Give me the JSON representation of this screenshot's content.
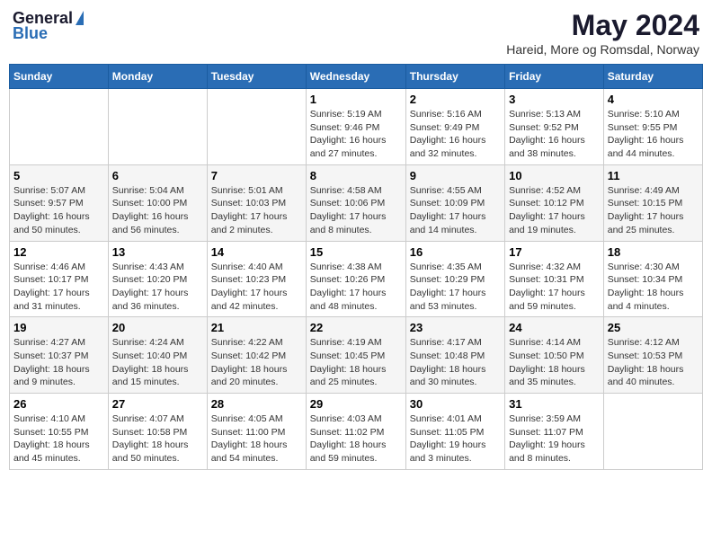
{
  "header": {
    "logo_general": "General",
    "logo_blue": "Blue",
    "month_year": "May 2024",
    "location": "Hareid, More og Romsdal, Norway"
  },
  "weekdays": [
    "Sunday",
    "Monday",
    "Tuesday",
    "Wednesday",
    "Thursday",
    "Friday",
    "Saturday"
  ],
  "weeks": [
    [
      {
        "day": "",
        "info": ""
      },
      {
        "day": "",
        "info": ""
      },
      {
        "day": "",
        "info": ""
      },
      {
        "day": "1",
        "info": "Sunrise: 5:19 AM\nSunset: 9:46 PM\nDaylight: 16 hours and 27 minutes."
      },
      {
        "day": "2",
        "info": "Sunrise: 5:16 AM\nSunset: 9:49 PM\nDaylight: 16 hours and 32 minutes."
      },
      {
        "day": "3",
        "info": "Sunrise: 5:13 AM\nSunset: 9:52 PM\nDaylight: 16 hours and 38 minutes."
      },
      {
        "day": "4",
        "info": "Sunrise: 5:10 AM\nSunset: 9:55 PM\nDaylight: 16 hours and 44 minutes."
      }
    ],
    [
      {
        "day": "5",
        "info": "Sunrise: 5:07 AM\nSunset: 9:57 PM\nDaylight: 16 hours and 50 minutes."
      },
      {
        "day": "6",
        "info": "Sunrise: 5:04 AM\nSunset: 10:00 PM\nDaylight: 16 hours and 56 minutes."
      },
      {
        "day": "7",
        "info": "Sunrise: 5:01 AM\nSunset: 10:03 PM\nDaylight: 17 hours and 2 minutes."
      },
      {
        "day": "8",
        "info": "Sunrise: 4:58 AM\nSunset: 10:06 PM\nDaylight: 17 hours and 8 minutes."
      },
      {
        "day": "9",
        "info": "Sunrise: 4:55 AM\nSunset: 10:09 PM\nDaylight: 17 hours and 14 minutes."
      },
      {
        "day": "10",
        "info": "Sunrise: 4:52 AM\nSunset: 10:12 PM\nDaylight: 17 hours and 19 minutes."
      },
      {
        "day": "11",
        "info": "Sunrise: 4:49 AM\nSunset: 10:15 PM\nDaylight: 17 hours and 25 minutes."
      }
    ],
    [
      {
        "day": "12",
        "info": "Sunrise: 4:46 AM\nSunset: 10:17 PM\nDaylight: 17 hours and 31 minutes."
      },
      {
        "day": "13",
        "info": "Sunrise: 4:43 AM\nSunset: 10:20 PM\nDaylight: 17 hours and 36 minutes."
      },
      {
        "day": "14",
        "info": "Sunrise: 4:40 AM\nSunset: 10:23 PM\nDaylight: 17 hours and 42 minutes."
      },
      {
        "day": "15",
        "info": "Sunrise: 4:38 AM\nSunset: 10:26 PM\nDaylight: 17 hours and 48 minutes."
      },
      {
        "day": "16",
        "info": "Sunrise: 4:35 AM\nSunset: 10:29 PM\nDaylight: 17 hours and 53 minutes."
      },
      {
        "day": "17",
        "info": "Sunrise: 4:32 AM\nSunset: 10:31 PM\nDaylight: 17 hours and 59 minutes."
      },
      {
        "day": "18",
        "info": "Sunrise: 4:30 AM\nSunset: 10:34 PM\nDaylight: 18 hours and 4 minutes."
      }
    ],
    [
      {
        "day": "19",
        "info": "Sunrise: 4:27 AM\nSunset: 10:37 PM\nDaylight: 18 hours and 9 minutes."
      },
      {
        "day": "20",
        "info": "Sunrise: 4:24 AM\nSunset: 10:40 PM\nDaylight: 18 hours and 15 minutes."
      },
      {
        "day": "21",
        "info": "Sunrise: 4:22 AM\nSunset: 10:42 PM\nDaylight: 18 hours and 20 minutes."
      },
      {
        "day": "22",
        "info": "Sunrise: 4:19 AM\nSunset: 10:45 PM\nDaylight: 18 hours and 25 minutes."
      },
      {
        "day": "23",
        "info": "Sunrise: 4:17 AM\nSunset: 10:48 PM\nDaylight: 18 hours and 30 minutes."
      },
      {
        "day": "24",
        "info": "Sunrise: 4:14 AM\nSunset: 10:50 PM\nDaylight: 18 hours and 35 minutes."
      },
      {
        "day": "25",
        "info": "Sunrise: 4:12 AM\nSunset: 10:53 PM\nDaylight: 18 hours and 40 minutes."
      }
    ],
    [
      {
        "day": "26",
        "info": "Sunrise: 4:10 AM\nSunset: 10:55 PM\nDaylight: 18 hours and 45 minutes."
      },
      {
        "day": "27",
        "info": "Sunrise: 4:07 AM\nSunset: 10:58 PM\nDaylight: 18 hours and 50 minutes."
      },
      {
        "day": "28",
        "info": "Sunrise: 4:05 AM\nSunset: 11:00 PM\nDaylight: 18 hours and 54 minutes."
      },
      {
        "day": "29",
        "info": "Sunrise: 4:03 AM\nSunset: 11:02 PM\nDaylight: 18 hours and 59 minutes."
      },
      {
        "day": "30",
        "info": "Sunrise: 4:01 AM\nSunset: 11:05 PM\nDaylight: 19 hours and 3 minutes."
      },
      {
        "day": "31",
        "info": "Sunrise: 3:59 AM\nSunset: 11:07 PM\nDaylight: 19 hours and 8 minutes."
      },
      {
        "day": "",
        "info": ""
      }
    ]
  ]
}
